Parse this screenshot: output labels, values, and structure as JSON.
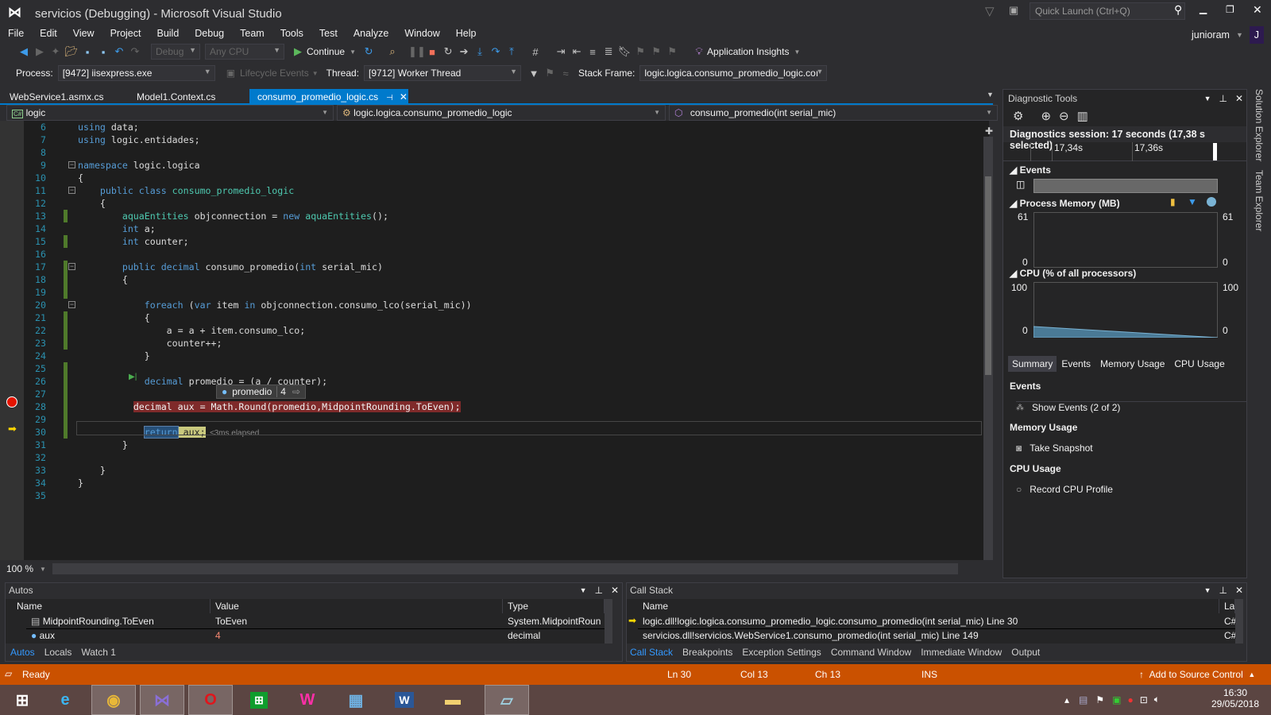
{
  "window": {
    "title": "servicios (Debugging) - Microsoft Visual Studio",
    "quick_launch_placeholder": "Quick Launch (Ctrl+Q)",
    "user": "junioram",
    "avatar_letter": "J"
  },
  "menu": [
    "File",
    "Edit",
    "View",
    "Project",
    "Build",
    "Debug",
    "Team",
    "Tools",
    "Test",
    "Analyze",
    "Window",
    "Help"
  ],
  "toolbar": {
    "config": "Debug",
    "platform": "Any CPU",
    "continue_label": "Continue",
    "app_insights": "Application Insights"
  },
  "debug_location": {
    "process_label": "Process:",
    "process": "[9472] iisexpress.exe",
    "lifecycle": "Lifecycle Events",
    "thread_label": "Thread:",
    "thread": "[9712] Worker Thread",
    "stack_frame_label": "Stack Frame:",
    "stack_frame": "logic.logica.consumo_promedio_logic.coı"
  },
  "tabs": [
    {
      "label": "WebService1.asmx.cs",
      "active": false
    },
    {
      "label": "Model1.Context.cs",
      "active": false
    },
    {
      "label": "consumo_promedio_logic.cs",
      "active": true
    }
  ],
  "navbar": {
    "project": "logic",
    "class": "logic.logica.consumo_promedio_logic",
    "member": "consumo_promedio(int serial_mic)"
  },
  "code": {
    "lines": [
      {
        "n": "6",
        "t": [
          [
            "kw",
            "using"
          ],
          [
            "tx",
            " data;"
          ]
        ]
      },
      {
        "n": "7",
        "t": [
          [
            "kw",
            "using"
          ],
          [
            "tx",
            " logic.entidades;"
          ]
        ]
      },
      {
        "n": "8",
        "t": []
      },
      {
        "n": "9",
        "t": [
          [
            "kw",
            "namespace"
          ],
          [
            "tx",
            " logic.logica"
          ]
        ]
      },
      {
        "n": "10",
        "t": [
          [
            "tx",
            "{"
          ]
        ]
      },
      {
        "n": "11",
        "t": [
          [
            "tx",
            "    "
          ],
          [
            "kw",
            "public class"
          ],
          [
            "tx",
            " "
          ],
          [
            "ty",
            "consumo_promedio_logic"
          ]
        ]
      },
      {
        "n": "12",
        "t": [
          [
            "tx",
            "    {"
          ]
        ]
      },
      {
        "n": "13",
        "t": [
          [
            "tx",
            "        "
          ],
          [
            "ty",
            "aquaEntities"
          ],
          [
            "tx",
            " objconnection = "
          ],
          [
            "kw",
            "new"
          ],
          [
            "tx",
            " "
          ],
          [
            "ty",
            "aquaEntities"
          ],
          [
            "tx",
            "();"
          ]
        ]
      },
      {
        "n": "14",
        "t": [
          [
            "tx",
            "        "
          ],
          [
            "kw",
            "int"
          ],
          [
            "tx",
            " a;"
          ]
        ]
      },
      {
        "n": "15",
        "t": [
          [
            "tx",
            "        "
          ],
          [
            "kw",
            "int"
          ],
          [
            "tx",
            " counter;"
          ]
        ]
      },
      {
        "n": "16",
        "t": []
      },
      {
        "n": "17",
        "t": [
          [
            "tx",
            "        "
          ],
          [
            "kw",
            "public decimal"
          ],
          [
            "tx",
            " consumo_promedio("
          ],
          [
            "kw",
            "int"
          ],
          [
            "tx",
            " serial_mic)"
          ]
        ]
      },
      {
        "n": "18",
        "t": [
          [
            "tx",
            "        {"
          ]
        ]
      },
      {
        "n": "19",
        "t": []
      },
      {
        "n": "20",
        "t": [
          [
            "tx",
            "            "
          ],
          [
            "kw",
            "foreach"
          ],
          [
            "tx",
            " ("
          ],
          [
            "kw",
            "var"
          ],
          [
            "tx",
            " item "
          ],
          [
            "kw",
            "in"
          ],
          [
            "tx",
            " objconnection.consumo_lco(serial_mic))"
          ]
        ]
      },
      {
        "n": "21",
        "t": [
          [
            "tx",
            "            {"
          ]
        ]
      },
      {
        "n": "22",
        "t": [
          [
            "tx",
            "                a = a + item.consumo_lco;"
          ]
        ]
      },
      {
        "n": "23",
        "t": [
          [
            "tx",
            "                counter++;"
          ]
        ]
      },
      {
        "n": "24",
        "t": [
          [
            "tx",
            "            }"
          ]
        ]
      },
      {
        "n": "25",
        "t": []
      },
      {
        "n": "26",
        "t": [
          [
            "tx",
            "            "
          ],
          [
            "kw",
            "decimal"
          ],
          [
            "tx",
            " promedio = (a / counter);"
          ]
        ]
      },
      {
        "n": "27",
        "t": []
      },
      {
        "n": "28",
        "t": [
          [
            "tx",
            "          "
          ],
          [
            "bp-hl",
            "decimal aux = Math.Round(promedio,MidpointRounding.ToEven);"
          ]
        ]
      },
      {
        "n": "29",
        "t": []
      },
      {
        "n": "30",
        "t": [
          [
            "tx",
            "            "
          ],
          [
            "ret kw",
            "return"
          ],
          [
            "auxhl",
            " aux;"
          ],
          [
            "elapsed",
            "  ≤3ms elapsed"
          ]
        ]
      },
      {
        "n": "31",
        "t": [
          [
            "tx",
            "        }"
          ]
        ]
      },
      {
        "n": "32",
        "t": []
      },
      {
        "n": "33",
        "t": [
          [
            "tx",
            "    }"
          ]
        ]
      },
      {
        "n": "34",
        "t": [
          [
            "tx",
            "}"
          ]
        ]
      },
      {
        "n": "35",
        "t": []
      }
    ],
    "datatip": {
      "name": "promedio",
      "value": "4"
    },
    "zoom": "100 %"
  },
  "diagnostics": {
    "title": "Diagnostic Tools",
    "session": "Diagnostics session: 17 seconds (17,38 s selected)",
    "ticks": [
      "17,34s",
      "17,36s"
    ],
    "events_label": "Events",
    "memory_label": "Process Memory (MB)",
    "memory_max": "61",
    "memory_min": "0",
    "cpu_label": "CPU (% of all processors)",
    "cpu_max": "100",
    "cpu_min": "0",
    "cpu_series_percent": [
      20,
      0
    ],
    "tabs": [
      "Summary",
      "Events",
      "Memory Usage",
      "CPU Usage"
    ],
    "summary": {
      "events_heading": "Events",
      "show_events": "Show Events (2 of 2)",
      "memory_heading": "Memory Usage",
      "take_snapshot": "Take Snapshot",
      "cpu_heading": "CPU Usage",
      "record_cpu": "Record CPU Profile"
    }
  },
  "side_tabs": [
    "Solution Explorer",
    "Team Explorer"
  ],
  "autos": {
    "title": "Autos",
    "columns": [
      "Name",
      "Value",
      "Type"
    ],
    "rows": [
      {
        "name": "MidpointRounding.ToEven",
        "value": "ToEven",
        "type": "System.MidpointRoun"
      },
      {
        "name": "aux",
        "value": "4",
        "type": "decimal"
      }
    ],
    "tabs": [
      "Autos",
      "Locals",
      "Watch 1"
    ]
  },
  "callstack": {
    "title": "Call Stack",
    "columns": [
      "Name",
      "Lang"
    ],
    "rows": [
      {
        "name": "logic.dll!logic.logica.consumo_promedio_logic.consumo_promedio(int serial_mic) Line 30",
        "lang": "C#"
      },
      {
        "name": "servicios.dll!servicios.WebService1.consumo_promedio(int serial_mic) Line 149",
        "lang": "C#"
      }
    ],
    "tabs": [
      "Call Stack",
      "Breakpoints",
      "Exception Settings",
      "Command Window",
      "Immediate Window",
      "Output"
    ]
  },
  "status": {
    "ready": "Ready",
    "ln": "Ln 30",
    "col": "Col 13",
    "ch": "Ch 13",
    "ins": "INS",
    "source_control": "Add to Source Control"
  },
  "taskbar": {
    "time": "16:30",
    "date": "29/05/2018"
  },
  "colors": {
    "accent": "#007acc",
    "status_bar": "#ca5100",
    "breakpoint": "#e51400"
  }
}
